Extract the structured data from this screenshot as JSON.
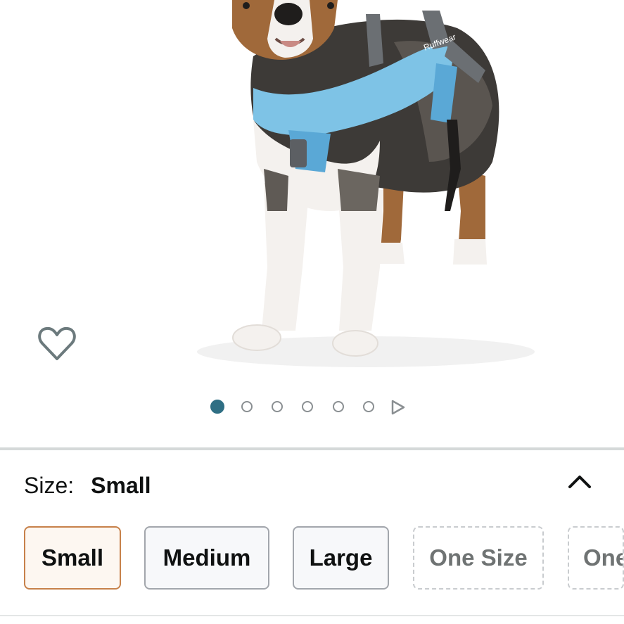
{
  "product_image": {
    "subject": "Dog wearing blue harness",
    "colors": {
      "harness": "#7ec3e6",
      "strap": "#6b6f73",
      "fur_dark": "#3d3a37",
      "fur_brown": "#a0693a",
      "fur_white": "#f4f1ee"
    }
  },
  "wishlist": {
    "icon": "heart-outline-icon",
    "color": "#6c7a7d"
  },
  "carousel": {
    "total": 6,
    "active_index": 0,
    "active_color": "#2f6f84",
    "next_icon": "play-triangle-icon"
  },
  "size": {
    "label": "Size:",
    "selected_value": "Small",
    "collapse_icon": "chevron-up-icon"
  },
  "size_options": [
    {
      "label": "Small",
      "state": "selected"
    },
    {
      "label": "Medium",
      "state": "available"
    },
    {
      "label": "Large",
      "state": "available"
    },
    {
      "label": "One Size",
      "state": "unavailable"
    },
    {
      "label": "One",
      "state": "unavailable"
    }
  ],
  "accent_colors": {
    "selected_border": "#c7814a",
    "selected_bg": "#fdf7f1"
  }
}
